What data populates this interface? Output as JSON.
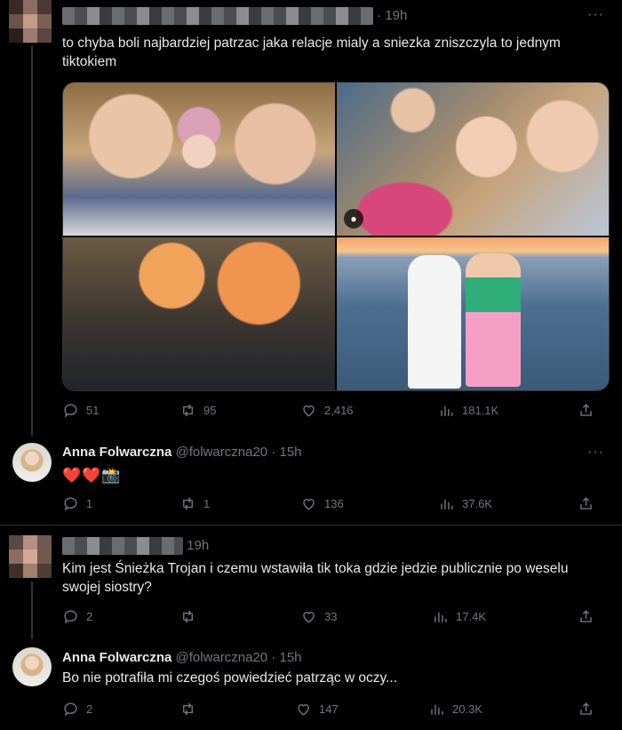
{
  "tweets": [
    {
      "time": "19h",
      "text": "to chyba boli najbardziej patrzac jaka relacje mialy a sniezka zniszczyla to jednym tiktokiem",
      "stats": {
        "replies": "51",
        "retweets": "95",
        "likes": "2,416",
        "views": "181.1K"
      }
    },
    {
      "name": "Anna Folwarczna",
      "handle": "@folwarczna20",
      "dot": "·",
      "time": "15h",
      "text": "❤️❤️📸",
      "stats": {
        "replies": "1",
        "retweets": "1",
        "likes": "136",
        "views": "37.6K"
      }
    },
    {
      "time": "19h",
      "text": "Kim jest Śnieżka Trojan i czemu wstawiła tik toka gdzie jedzie publicznie po weselu swojej siostry?",
      "stats": {
        "replies": "2",
        "retweets": "",
        "likes": "33",
        "views": "17.4K"
      }
    },
    {
      "name": "Anna Folwarczna",
      "handle": "@folwarczna20",
      "dot": "·",
      "time": "15h",
      "text": "Bo nie potrafiła mi czegoś powiedzieć patrząc w oczy...",
      "stats": {
        "replies": "2",
        "retweets": "",
        "likes": "147",
        "views": "20.3K"
      }
    }
  ],
  "more_label": "···",
  "dot": "·",
  "icons": {
    "reply": "reply-icon",
    "retweet": "retweet-icon",
    "like": "heart-icon",
    "views": "views-icon",
    "share": "share-icon",
    "tagged": "person-icon"
  },
  "colors": {
    "background": "#000000",
    "text": "#e7e9ea",
    "muted": "#71767b",
    "divider": "#2f3336"
  }
}
